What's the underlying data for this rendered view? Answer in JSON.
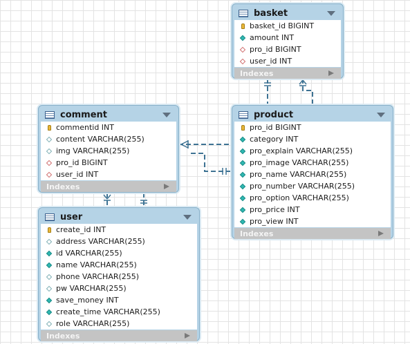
{
  "entities": [
    {
      "key": "basket",
      "title": "basket",
      "indexes_label": "Indexes",
      "columns": [
        {
          "text": "basket_id BIGINT",
          "icon": "primary-key-icon"
        },
        {
          "text": "amount INT",
          "icon": "not-null-column-icon"
        },
        {
          "text": "pro_id BIGINT",
          "icon": "foreign-key-icon"
        },
        {
          "text": "user_id INT",
          "icon": "foreign-key-icon"
        }
      ]
    },
    {
      "key": "comment",
      "title": "comment",
      "indexes_label": "Indexes",
      "columns": [
        {
          "text": "commentid INT",
          "icon": "primary-key-icon"
        },
        {
          "text": "content VARCHAR(255)",
          "icon": "nullable-column-icon"
        },
        {
          "text": "img VARCHAR(255)",
          "icon": "nullable-column-icon"
        },
        {
          "text": "pro_id BIGINT",
          "icon": "foreign-key-icon"
        },
        {
          "text": "user_id INT",
          "icon": "foreign-key-icon"
        }
      ]
    },
    {
      "key": "product",
      "title": "product",
      "indexes_label": "Indexes",
      "columns": [
        {
          "text": "pro_id BIGINT",
          "icon": "primary-key-icon"
        },
        {
          "text": "category INT",
          "icon": "not-null-column-icon"
        },
        {
          "text": "pro_explain VARCHAR(255)",
          "icon": "not-null-column-icon"
        },
        {
          "text": "pro_image VARCHAR(255)",
          "icon": "not-null-column-icon"
        },
        {
          "text": "pro_name VARCHAR(255)",
          "icon": "not-null-column-icon"
        },
        {
          "text": "pro_number VARCHAR(255)",
          "icon": "not-null-column-icon"
        },
        {
          "text": "pro_option VARCHAR(255)",
          "icon": "not-null-column-icon"
        },
        {
          "text": "pro_price INT",
          "icon": "not-null-column-icon"
        },
        {
          "text": "pro_view INT",
          "icon": "not-null-column-icon"
        }
      ]
    },
    {
      "key": "user",
      "title": "user",
      "indexes_label": "Indexes",
      "columns": [
        {
          "text": "create_id INT",
          "icon": "primary-key-icon"
        },
        {
          "text": "address VARCHAR(255)",
          "icon": "nullable-column-icon"
        },
        {
          "text": "id VARCHAR(255)",
          "icon": "not-null-column-icon"
        },
        {
          "text": "name VARCHAR(255)",
          "icon": "not-null-column-icon"
        },
        {
          "text": "phone VARCHAR(255)",
          "icon": "nullable-column-icon"
        },
        {
          "text": "pw VARCHAR(255)",
          "icon": "nullable-column-icon"
        },
        {
          "text": "save_money INT",
          "icon": "not-null-column-icon"
        },
        {
          "text": "create_time VARCHAR(255)",
          "icon": "not-null-column-icon"
        },
        {
          "text": "role VARCHAR(255)",
          "icon": "nullable-column-icon"
        }
      ]
    }
  ],
  "relationships": [
    {
      "from": "comment",
      "to": "product",
      "type": "one-to-many",
      "name": "comment-product-relationship"
    },
    {
      "from": "basket",
      "to": "product",
      "type": "one-to-many",
      "name": "basket-product-relationship"
    },
    {
      "from": "comment",
      "to": "user",
      "type": "one-to-many",
      "name": "comment-user-relationship"
    }
  ],
  "colors": {
    "entity_border": "#87b0c9",
    "entity_header": "#b5d3e6",
    "connector": "#3d7293",
    "indexes_bar": "#c4c4c4"
  }
}
